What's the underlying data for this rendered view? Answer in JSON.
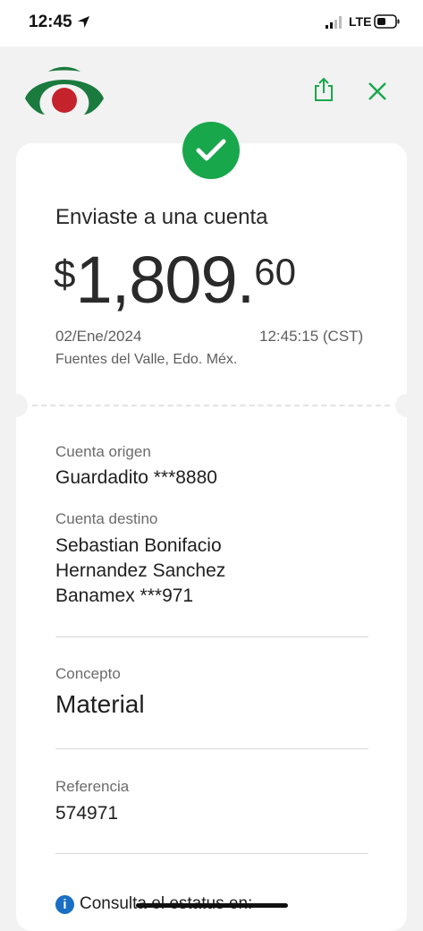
{
  "status_bar": {
    "time": "12:45",
    "network": "LTE"
  },
  "header": {
    "logo_icon": "bank-logo-icon",
    "share_icon": "share-icon",
    "close_icon": "close-icon"
  },
  "receipt": {
    "headline": "Enviaste a una cuenta",
    "amount_symbol": "$",
    "amount_main": "1,809.",
    "amount_cents": "60",
    "date": "02/Ene/2024",
    "time": "12:45:15 (CST)",
    "place": "Fuentes del Valle, Edo. Méx."
  },
  "details": {
    "origin_label": "Cuenta origen",
    "origin_value": "Guardadito ***8880",
    "dest_label": "Cuenta destino",
    "dest_name_line1": "Sebastian Bonifacio",
    "dest_name_line2": "Hernandez Sanchez",
    "dest_account": "Banamex ***971",
    "concept_label": "Concepto",
    "concept_value": "Material",
    "reference_label": "Referencia",
    "reference_value": "574971"
  },
  "footer": {
    "info_text": "Consulta el estatus en:"
  },
  "colors": {
    "accent_green": "#19a74c",
    "logo_green": "#1b7a3e",
    "logo_red": "#c4232b",
    "info_blue": "#1a6fc4"
  }
}
